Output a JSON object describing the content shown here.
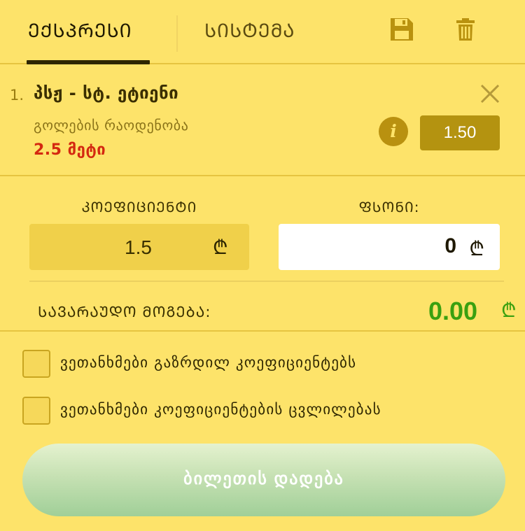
{
  "tabs": [
    {
      "label": "ᲔᲥᲡᲞᲠᲔᲡᲘ",
      "active": true
    },
    {
      "label": "ᲡᲘᲡᲢᲔᲛᲐ",
      "active": false
    }
  ],
  "toolbar": {
    "save_icon": "floppy-disk-icon",
    "delete_icon": "trash-icon"
  },
  "bet": {
    "index": "1.",
    "match": "პსჟ - სტ. ეტიენი",
    "market": "გოლების რაოდენობა",
    "selection": "2.5 მეტი",
    "odds": "1.50",
    "close_icon": "close-icon",
    "info_icon": "info-icon",
    "info_glyph": "i"
  },
  "stake": {
    "coef_label": "ᲙᲝᲔᲤᲘᲪᲘᲔᲜᲢᲘ",
    "stake_label": "ᲤᲡᲝᲜᲘ:",
    "coef_value": "1.5",
    "stake_value": "0",
    "currency": "₾",
    "win_label": "ᲡᲐᲕᲐᲠᲐᲣᲓᲝ ᲛᲝᲒᲔᲑᲐ:",
    "win_value": "0.00"
  },
  "options": [
    {
      "label": "ვეთანხმები გაზრდილ კოეფიციენტებს",
      "checked": false
    },
    {
      "label": "ვეთანხმები კოეფიციენტების ცვლილებას",
      "checked": false
    }
  ],
  "place_bet": {
    "label": "ბილეთის დადება"
  },
  "colors": {
    "background": "#fde36a",
    "odds_badge": "#b49310",
    "selection_red": "#d42810",
    "win_green": "#3aa010",
    "button_green": "#a0cf98"
  }
}
